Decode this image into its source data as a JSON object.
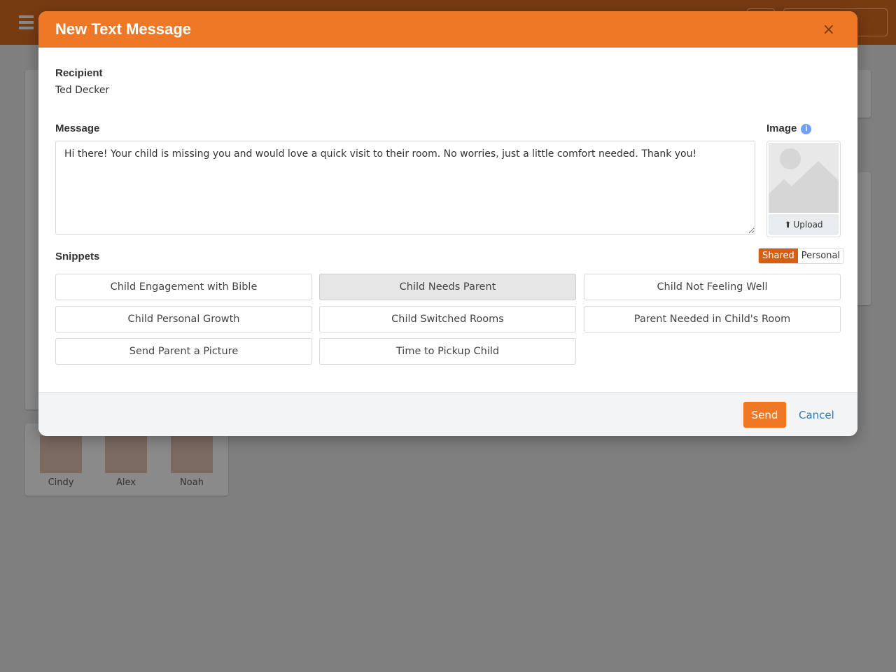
{
  "modal": {
    "title": "New Text Message",
    "close_label": "×",
    "recipient_label": "Recipient",
    "recipient": "Ted Decker",
    "message_label": "Message",
    "message": "Hi there! Your child is missing you and would love a quick visit to their room. No worries, just a little comfort needed. Thank you!",
    "image_label": "Image",
    "upload_label": "Upload",
    "snippets_label": "Snippets",
    "snippet_tabs": [
      "Shared",
      "Personal"
    ],
    "snippets": [
      "Child Engagement with Bible",
      "Child Needs Parent",
      "Child Not Feeling Well",
      "Child Personal Growth",
      "Child Switched Rooms",
      "Parent Needed in Child's Room",
      "Send Parent a Picture",
      "Time to Pickup Child"
    ],
    "send_label": "Send",
    "cancel_label": "Cancel"
  },
  "background": {
    "family": [
      "Cindy",
      "Alex",
      "Noah"
    ]
  },
  "colors": {
    "accent": "#ef7826",
    "topbar": "#773b12",
    "selected_tab": "#d45f15",
    "link": "#2a7bc0"
  }
}
